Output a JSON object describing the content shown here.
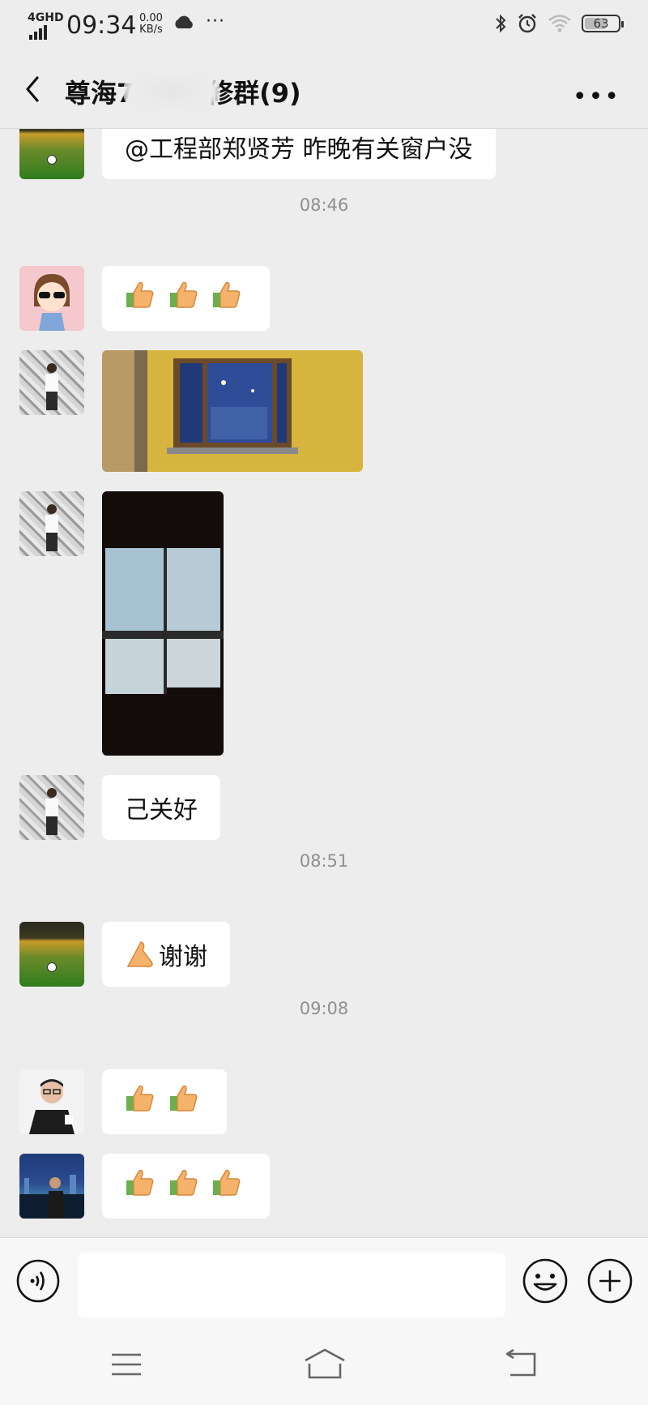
{
  "status_bar": {
    "network": "4GHD",
    "time": "09:34",
    "speed_value": "0.00",
    "speed_unit": "KB/s",
    "battery": "63"
  },
  "header": {
    "title": "尊海7B1  装修群(9)"
  },
  "messages": [
    {
      "type": "text",
      "text": "@工程部郑贤芳  昨晚有关窗户没",
      "avatar": "football-field-avatar"
    },
    {
      "type": "time",
      "text": "08:46"
    },
    {
      "type": "emoji",
      "count": 3,
      "avatar": "cartoon-girl-avatar"
    },
    {
      "type": "image",
      "avatar": "man-white-shirt-avatar",
      "description_icon": "photo-window-night"
    },
    {
      "type": "image",
      "avatar": "man-white-shirt-avatar",
      "description_icon": "photo-frosted-window"
    },
    {
      "type": "text",
      "text": "己关好",
      "avatar": "man-white-shirt-avatar"
    },
    {
      "type": "time",
      "text": "08:51"
    },
    {
      "type": "text",
      "text": "谢谢",
      "avatar": "football-field-avatar",
      "prefix_icon": "bow-hands-icon"
    },
    {
      "type": "time",
      "text": "09:08"
    },
    {
      "type": "emoji",
      "count": 2,
      "avatar": "man-glasses-avatar"
    },
    {
      "type": "emoji",
      "count": 3,
      "avatar": "night-city-avatar"
    }
  ],
  "composer": {
    "placeholder": ""
  },
  "colors": {
    "background": "#ededed",
    "bubble": "#ffffff",
    "time_text": "#8f8f8f"
  }
}
